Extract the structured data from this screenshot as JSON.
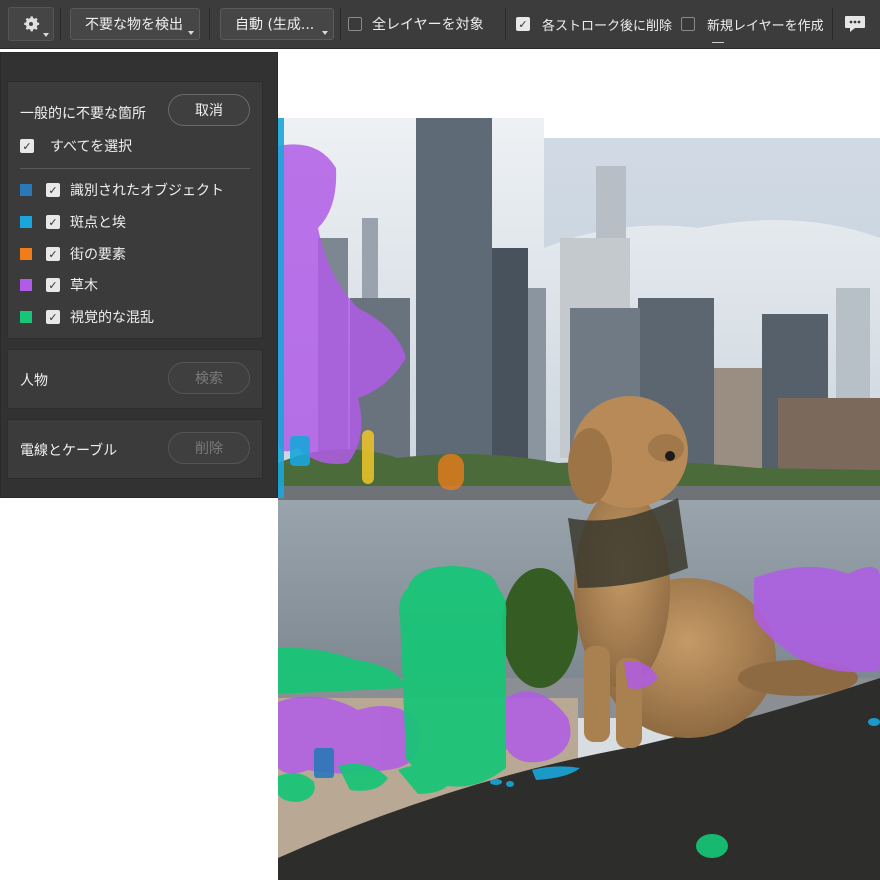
{
  "toolbar": {
    "settings_icon": "gear-icon",
    "detect_label": "不要な物を検出",
    "mode_label": "自動 (生成...",
    "all_layers_label": "全レイヤーを対象",
    "all_layers_checked": false,
    "delete_after_stroke_label": "各ストローク後に削除",
    "delete_after_stroke_checked": true,
    "new_layer_label": "新規レイヤーを作成",
    "new_layer_checked": false,
    "feedback_icon": "speech-bubble-icon"
  },
  "panel": {
    "general": {
      "title": "一般的に不要な箇所",
      "cancel_label": "取消",
      "select_all_label": "すべてを選択",
      "select_all_checked": true,
      "items": [
        {
          "label": "識別されたオブジェクト",
          "color": "#2a78b8",
          "checked": true
        },
        {
          "label": "斑点と埃",
          "color": "#1aa6dc",
          "checked": true
        },
        {
          "label": "街の要素",
          "color": "#f07c1a",
          "checked": true
        },
        {
          "label": "草木",
          "color": "#b05ce6",
          "checked": true
        },
        {
          "label": "視覚的な混乱",
          "color": "#16c676",
          "checked": true
        }
      ]
    },
    "people": {
      "title": "人物",
      "action_label": "検索"
    },
    "wires": {
      "title": "電線とケーブル",
      "action_label": "削除"
    }
  },
  "colors": {
    "vegetation_overlay": "#b05ce6",
    "clutter_overlay": "#16c676",
    "dust_overlay": "#1aa6dc",
    "street_overlay": "#f07c1a"
  }
}
